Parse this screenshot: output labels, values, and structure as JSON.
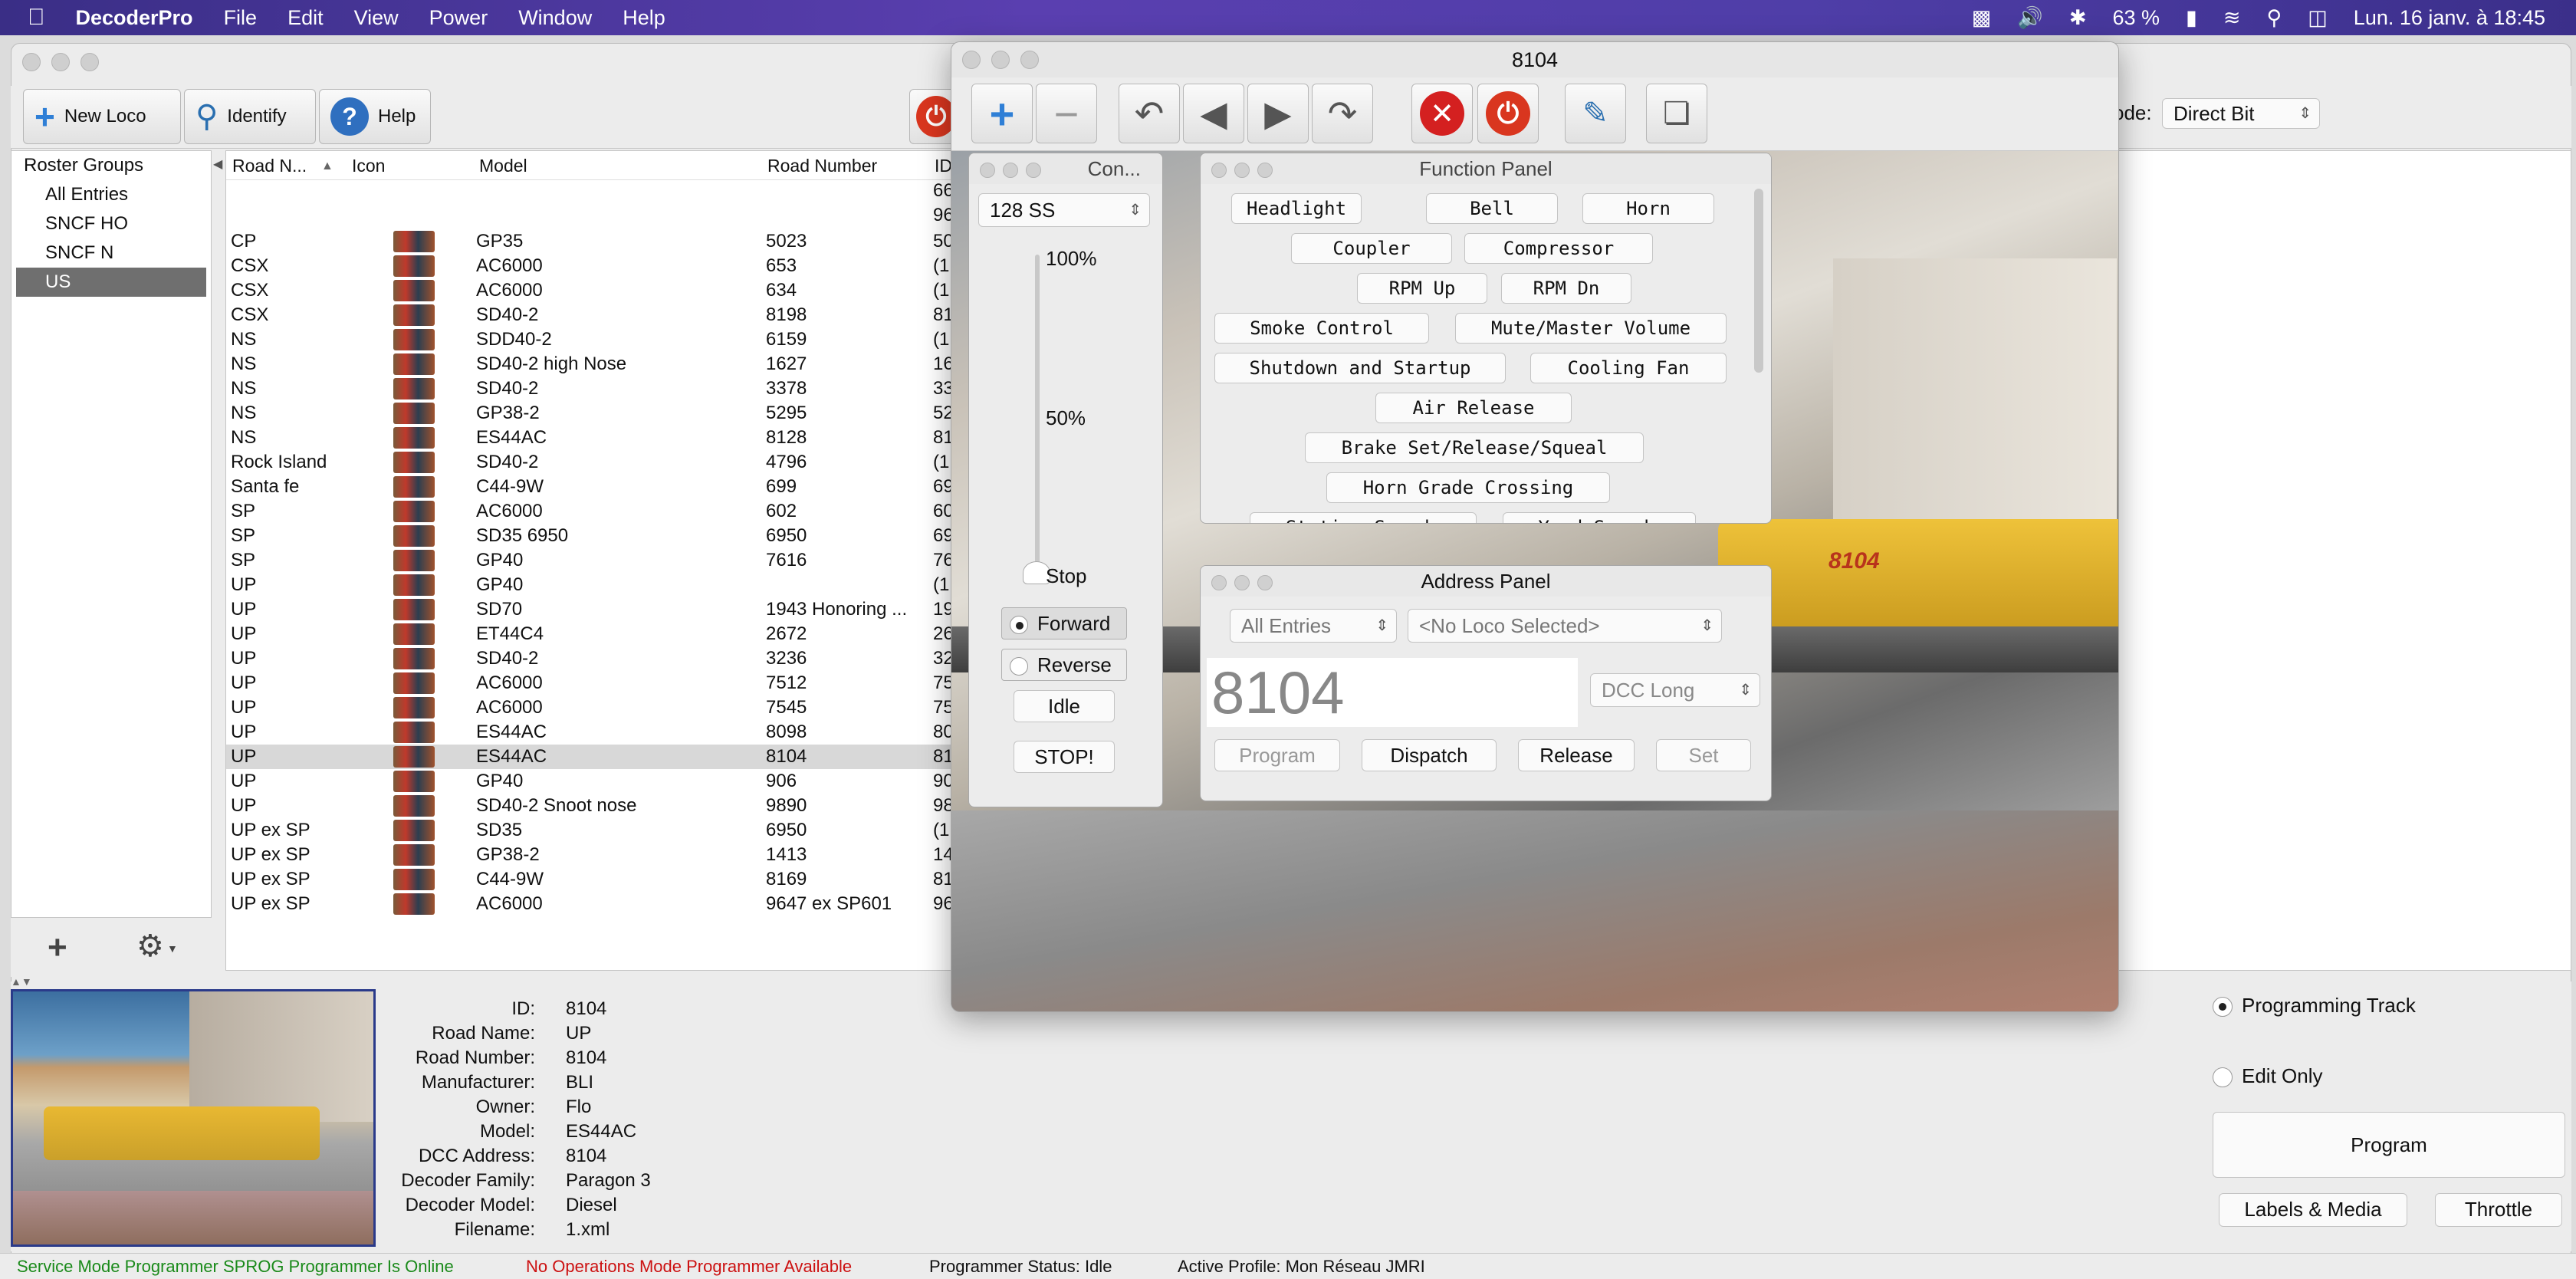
{
  "menubar": {
    "app": "DecoderPro",
    "items": [
      "File",
      "Edit",
      "View",
      "Power",
      "Window",
      "Help"
    ],
    "battery": "63 %",
    "datetime": "Lun. 16 janv. à  18:45"
  },
  "toolbar": {
    "new_loco": "New Loco",
    "identify": "Identify",
    "help": "Help",
    "mode_label": "ode:",
    "mode_value": "Direct Bit"
  },
  "groups": {
    "header": "Roster Groups",
    "items": [
      "All Entries",
      "SNCF HO",
      "SNCF N",
      "US"
    ],
    "selected": "US"
  },
  "roster": {
    "columns": [
      "Road N...",
      "Icon",
      "Model",
      "Road Number",
      "ID"
    ],
    "top_id_fragments": [
      "66",
      "96"
    ],
    "rows": [
      {
        "road": "CP",
        "model": "GP35",
        "number": "5023",
        "id": "50"
      },
      {
        "road": "CSX",
        "model": "AC6000",
        "number": "653",
        "id": "(1"
      },
      {
        "road": "CSX",
        "model": "AC6000",
        "number": "634",
        "id": "(1"
      },
      {
        "road": "CSX",
        "model": "SD40-2",
        "number": "8198",
        "id": "81"
      },
      {
        "road": "NS",
        "model": "SDD40-2",
        "number": "6159",
        "id": "(1"
      },
      {
        "road": "NS",
        "model": "SD40-2 high Nose",
        "number": "1627",
        "id": "16"
      },
      {
        "road": "NS",
        "model": "SD40-2",
        "number": "3378",
        "id": "33"
      },
      {
        "road": "NS",
        "model": "GP38-2",
        "number": "5295",
        "id": "52"
      },
      {
        "road": "NS",
        "model": "ES44AC",
        "number": "8128",
        "id": "81"
      },
      {
        "road": "Rock Island",
        "model": "SD40-2",
        "number": "4796",
        "id": "(1"
      },
      {
        "road": "Santa fe",
        "model": "C44-9W",
        "number": "699",
        "id": "69"
      },
      {
        "road": "SP",
        "model": "AC6000",
        "number": "602",
        "id": "60"
      },
      {
        "road": "SP",
        "model": "SD35 6950",
        "number": "6950",
        "id": "69"
      },
      {
        "road": "SP",
        "model": "GP40",
        "number": "7616",
        "id": "76"
      },
      {
        "road": "UP",
        "model": "GP40",
        "number": "",
        "id": "(1"
      },
      {
        "road": "UP",
        "model": "SD70",
        "number": "1943 Honoring ...",
        "id": "19"
      },
      {
        "road": "UP",
        "model": "ET44C4",
        "number": "2672",
        "id": "26"
      },
      {
        "road": "UP",
        "model": "SD40-2",
        "number": "3236",
        "id": "32"
      },
      {
        "road": "UP",
        "model": "AC6000",
        "number": "7512",
        "id": "75"
      },
      {
        "road": "UP",
        "model": "AC6000",
        "number": "7545",
        "id": "75"
      },
      {
        "road": "UP",
        "model": "ES44AC",
        "number": "8098",
        "id": "80"
      },
      {
        "road": "UP",
        "model": "ES44AC",
        "number": "8104",
        "id": "81"
      },
      {
        "road": "UP",
        "model": "GP40",
        "number": "906",
        "id": "90"
      },
      {
        "road": "UP",
        "model": "SD40-2 Snoot nose",
        "number": "9890",
        "id": "98"
      },
      {
        "road": "UP ex SP",
        "model": "SD35",
        "number": "6950",
        "id": "(1"
      },
      {
        "road": "UP ex SP",
        "model": "GP38-2",
        "number": "1413",
        "id": "14"
      },
      {
        "road": "UP ex SP",
        "model": "C44-9W",
        "number": "8169",
        "id": "81"
      },
      {
        "road": "UP ex SP",
        "model": "AC6000",
        "number": "9647 ex SP601",
        "id": "96"
      }
    ],
    "selected_index": 21
  },
  "details": {
    "labels": [
      "ID:",
      "Road Name:",
      "Road Number:",
      "Manufacturer:",
      "Owner:",
      "Model:",
      "DCC Address:",
      "Decoder Family:",
      "Decoder Model:",
      "Filename:"
    ],
    "values": [
      "8104",
      "UP",
      "8104",
      "BLI",
      "Flo",
      "ES44AC",
      "8104",
      "Paragon 3",
      "Diesel",
      "1.xml"
    ]
  },
  "programming": {
    "programming_track": "Programming Track",
    "edit_only": "Edit Only",
    "program": "Program",
    "labels_media": "Labels & Media",
    "throttle": "Throttle",
    "selected": "programming_track"
  },
  "status": {
    "service": "Service Mode Programmer SPROG Programmer Is Online",
    "ops": "No Operations Mode Programmer Available",
    "prog_status": "Programmer Status:  Idle",
    "profile": "Active Profile: Mon Réseau JMRI",
    "service_color": "#1a8a1a",
    "ops_color": "#cc1111"
  },
  "throttle_window": {
    "title": "8104",
    "control": {
      "title": "Con...",
      "speed_steps": "128 SS",
      "label_100": "100%",
      "label_50": "50%",
      "label_stop": "Stop",
      "forward": "Forward",
      "reverse": "Reverse",
      "idle": "Idle",
      "stop_button": "STOP!",
      "speed_fraction": 0
    },
    "function_panel": {
      "title": "Function Panel",
      "buttons": [
        "Headlight",
        "Bell",
        "Horn",
        "Coupler",
        "Compressor",
        "RPM Up",
        "RPM Dn",
        "Smoke Control",
        "Mute/Master Volume",
        "Shutdown and Startup",
        "Cooling Fan",
        "Air Release",
        "Brake Set/Release/Squeal",
        "Horn Grade Crossing",
        "Station Sounds",
        "Yard Sounds"
      ]
    },
    "address_panel": {
      "title": "Address Panel",
      "roster_filter": "All Entries",
      "loco_select": "<No Loco Selected>",
      "address": "8104",
      "address_type": "DCC Long",
      "program": "Program",
      "dispatch": "Dispatch",
      "release": "Release",
      "set": "Set"
    },
    "loco_number_on_photo": "8104"
  },
  "colors": {
    "power_red": "#d9361f",
    "stop_red": "#d42020",
    "blue_plus": "#2f7fd6"
  }
}
